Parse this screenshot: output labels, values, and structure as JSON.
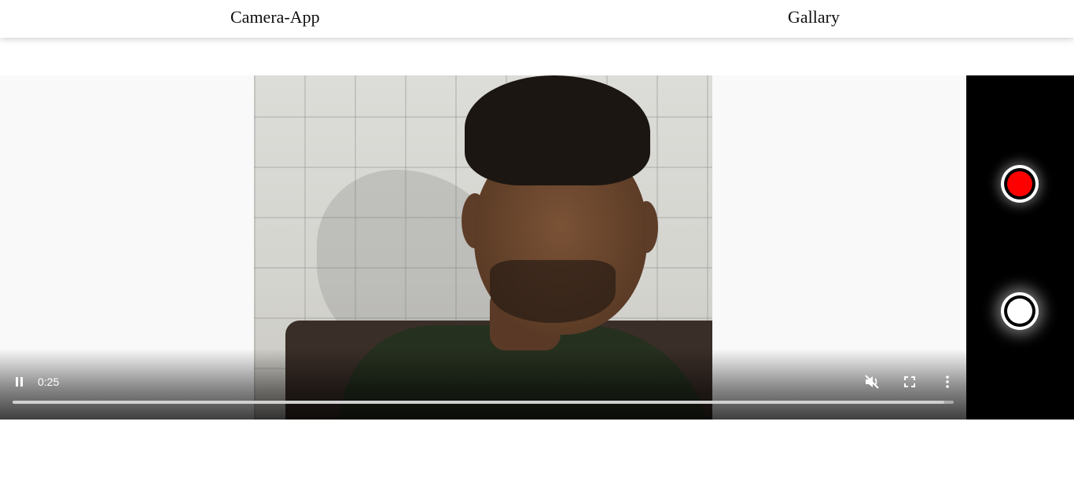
{
  "nav": {
    "camera_label": "Camera-App",
    "gallery_label": "Gallary"
  },
  "video": {
    "current_time": "0:25",
    "progress": 0.99,
    "muted": true,
    "state": "playing"
  },
  "controls": {
    "record_color": "#ff0000",
    "capture_color": "#ffffff",
    "panel_color": "#000000"
  },
  "icons": {
    "pause": "pause-icon",
    "mute": "volume-muted-icon",
    "fullscreen": "fullscreen-icon",
    "more": "more-vertical-icon"
  }
}
